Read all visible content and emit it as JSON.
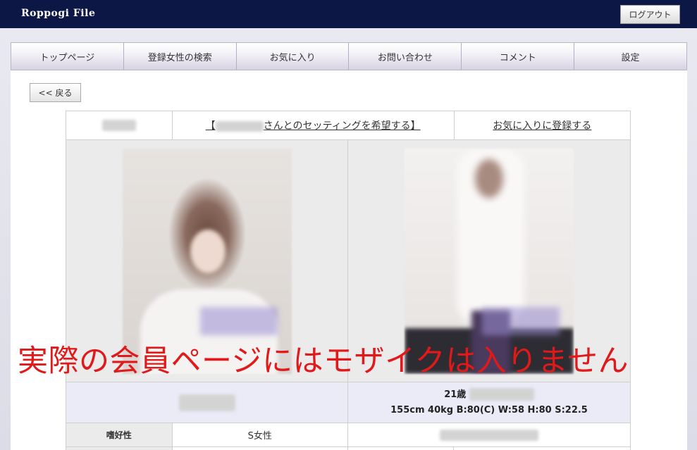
{
  "header": {
    "brand": "Roppogi File",
    "logout_label": "ログアウト"
  },
  "nav": {
    "items": [
      "トップページ",
      "登録女性の検索",
      "お気に入り",
      "お問い合わせ",
      "コメント",
      "設定"
    ]
  },
  "back_label": "<< 戻る",
  "profile": {
    "request_link_prefix": "【",
    "request_link_suffix": "さんとのセッティングを希望する】",
    "favorite_link": "お気に入りに登録する",
    "age": "21歳",
    "stats": "155cm  40kg  B:80(C) W:58 H:80 S:22.5",
    "attr_label": "嗜好性",
    "attr_value": "S女性"
  },
  "notice": "実際の会員ページにはモザイクは入りません",
  "colors": {
    "header_bg": "#0c1745",
    "notice": "#e0191a",
    "info_bg": "#ebebf8"
  }
}
